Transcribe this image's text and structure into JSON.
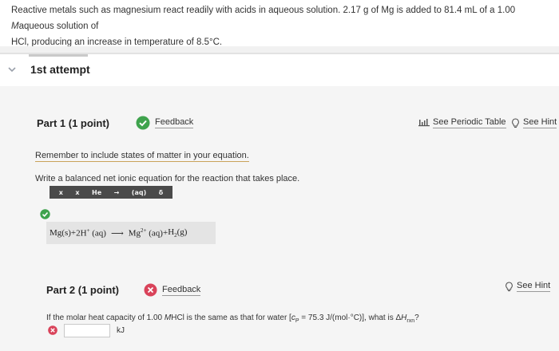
{
  "question": {
    "line1_pre": "Reactive metals such as magnesium react readily with acids in aqueous solution. 2.17 g of Mg is added to 81.4 mL of a 1.00 ",
    "line1_ital": "M",
    "line1_post": "aqueous solution of",
    "line2": "HCl, producing an increase in temperature of 8.5°C."
  },
  "attempt": {
    "label": "1st attempt"
  },
  "part1": {
    "title": "Part 1  (1 point)",
    "feedback": "Feedback",
    "periodic_table": "See Periodic Table",
    "hint": "See Hint",
    "reminder": "Remember to include states of matter in your equation.",
    "instruction": "Write a balanced net ionic equation for the reaction that takes place.",
    "toolbar": [
      "x",
      "x",
      "He",
      "→",
      "(aq)",
      "δ"
    ],
    "equation": {
      "mg": "Mg(s)",
      "plus1": " + ",
      "h_ion": "2H",
      "h_charge": "+",
      "h_state": "(aq)",
      "mg_ion": "Mg",
      "mg_charge": "2+",
      "mg_state": "(aq)",
      "plus2": " + ",
      "h2": "H",
      "h2_sub": "2",
      "h2_state": "(g)"
    },
    "colors": {
      "correct": "#3fa34d"
    }
  },
  "part2": {
    "title": "Part 2  (1 point)",
    "feedback": "Feedback",
    "hint": "See Hint",
    "question_pre": "If the molar heat capacity of 1.00 ",
    "question_m": "M",
    "question_mid": "HCl is the same as that for water [",
    "cp": "c",
    "cp_sub": "P",
    "cp_value": " = 75.3 J/(mol·°C)], what is Δ",
    "h": "H",
    "h_sub": "rxn",
    "question_end": "?",
    "unit": "kJ",
    "colors": {
      "incorrect": "#d9435a"
    }
  }
}
